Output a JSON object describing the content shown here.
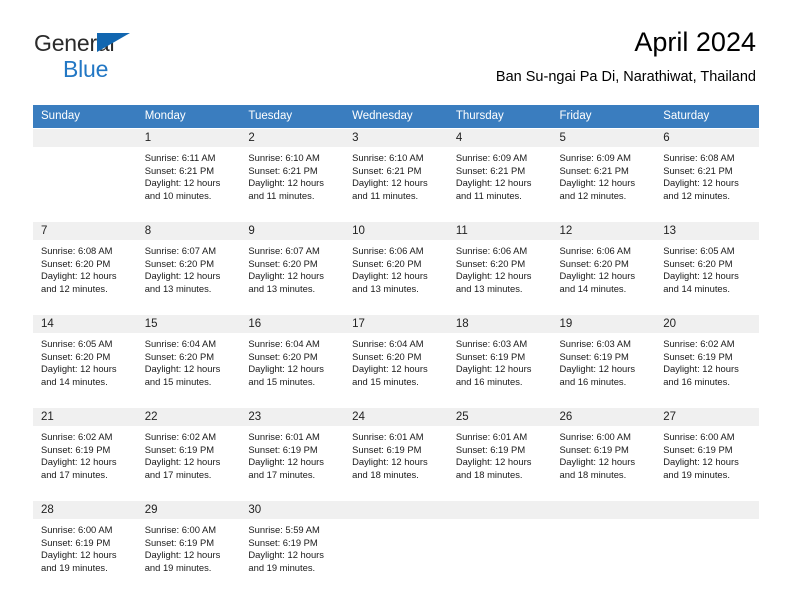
{
  "brand": {
    "name_part1": "General",
    "name_part2": "Blue",
    "accent_color": "#1166b0",
    "blue_text_color": "#2277c4"
  },
  "header": {
    "title": "April 2024",
    "subtitle": "Ban Su-ngai Pa Di, Narathiwat, Thailand"
  },
  "calendar": {
    "header_bg": "#3a7dbf",
    "daynum_bg": "#f0f0f0",
    "weekdays": [
      "Sunday",
      "Monday",
      "Tuesday",
      "Wednesday",
      "Thursday",
      "Friday",
      "Saturday"
    ],
    "weeks": [
      [
        {
          "day": "",
          "lines": []
        },
        {
          "day": "1",
          "lines": [
            "Sunrise: 6:11 AM",
            "Sunset: 6:21 PM",
            "Daylight: 12 hours",
            "and 10 minutes."
          ]
        },
        {
          "day": "2",
          "lines": [
            "Sunrise: 6:10 AM",
            "Sunset: 6:21 PM",
            "Daylight: 12 hours",
            "and 11 minutes."
          ]
        },
        {
          "day": "3",
          "lines": [
            "Sunrise: 6:10 AM",
            "Sunset: 6:21 PM",
            "Daylight: 12 hours",
            "and 11 minutes."
          ]
        },
        {
          "day": "4",
          "lines": [
            "Sunrise: 6:09 AM",
            "Sunset: 6:21 PM",
            "Daylight: 12 hours",
            "and 11 minutes."
          ]
        },
        {
          "day": "5",
          "lines": [
            "Sunrise: 6:09 AM",
            "Sunset: 6:21 PM",
            "Daylight: 12 hours",
            "and 12 minutes."
          ]
        },
        {
          "day": "6",
          "lines": [
            "Sunrise: 6:08 AM",
            "Sunset: 6:21 PM",
            "Daylight: 12 hours",
            "and 12 minutes."
          ]
        }
      ],
      [
        {
          "day": "7",
          "lines": [
            "Sunrise: 6:08 AM",
            "Sunset: 6:20 PM",
            "Daylight: 12 hours",
            "and 12 minutes."
          ]
        },
        {
          "day": "8",
          "lines": [
            "Sunrise: 6:07 AM",
            "Sunset: 6:20 PM",
            "Daylight: 12 hours",
            "and 13 minutes."
          ]
        },
        {
          "day": "9",
          "lines": [
            "Sunrise: 6:07 AM",
            "Sunset: 6:20 PM",
            "Daylight: 12 hours",
            "and 13 minutes."
          ]
        },
        {
          "day": "10",
          "lines": [
            "Sunrise: 6:06 AM",
            "Sunset: 6:20 PM",
            "Daylight: 12 hours",
            "and 13 minutes."
          ]
        },
        {
          "day": "11",
          "lines": [
            "Sunrise: 6:06 AM",
            "Sunset: 6:20 PM",
            "Daylight: 12 hours",
            "and 13 minutes."
          ]
        },
        {
          "day": "12",
          "lines": [
            "Sunrise: 6:06 AM",
            "Sunset: 6:20 PM",
            "Daylight: 12 hours",
            "and 14 minutes."
          ]
        },
        {
          "day": "13",
          "lines": [
            "Sunrise: 6:05 AM",
            "Sunset: 6:20 PM",
            "Daylight: 12 hours",
            "and 14 minutes."
          ]
        }
      ],
      [
        {
          "day": "14",
          "lines": [
            "Sunrise: 6:05 AM",
            "Sunset: 6:20 PM",
            "Daylight: 12 hours",
            "and 14 minutes."
          ]
        },
        {
          "day": "15",
          "lines": [
            "Sunrise: 6:04 AM",
            "Sunset: 6:20 PM",
            "Daylight: 12 hours",
            "and 15 minutes."
          ]
        },
        {
          "day": "16",
          "lines": [
            "Sunrise: 6:04 AM",
            "Sunset: 6:20 PM",
            "Daylight: 12 hours",
            "and 15 minutes."
          ]
        },
        {
          "day": "17",
          "lines": [
            "Sunrise: 6:04 AM",
            "Sunset: 6:20 PM",
            "Daylight: 12 hours",
            "and 15 minutes."
          ]
        },
        {
          "day": "18",
          "lines": [
            "Sunrise: 6:03 AM",
            "Sunset: 6:19 PM",
            "Daylight: 12 hours",
            "and 16 minutes."
          ]
        },
        {
          "day": "19",
          "lines": [
            "Sunrise: 6:03 AM",
            "Sunset: 6:19 PM",
            "Daylight: 12 hours",
            "and 16 minutes."
          ]
        },
        {
          "day": "20",
          "lines": [
            "Sunrise: 6:02 AM",
            "Sunset: 6:19 PM",
            "Daylight: 12 hours",
            "and 16 minutes."
          ]
        }
      ],
      [
        {
          "day": "21",
          "lines": [
            "Sunrise: 6:02 AM",
            "Sunset: 6:19 PM",
            "Daylight: 12 hours",
            "and 17 minutes."
          ]
        },
        {
          "day": "22",
          "lines": [
            "Sunrise: 6:02 AM",
            "Sunset: 6:19 PM",
            "Daylight: 12 hours",
            "and 17 minutes."
          ]
        },
        {
          "day": "23",
          "lines": [
            "Sunrise: 6:01 AM",
            "Sunset: 6:19 PM",
            "Daylight: 12 hours",
            "and 17 minutes."
          ]
        },
        {
          "day": "24",
          "lines": [
            "Sunrise: 6:01 AM",
            "Sunset: 6:19 PM",
            "Daylight: 12 hours",
            "and 18 minutes."
          ]
        },
        {
          "day": "25",
          "lines": [
            "Sunrise: 6:01 AM",
            "Sunset: 6:19 PM",
            "Daylight: 12 hours",
            "and 18 minutes."
          ]
        },
        {
          "day": "26",
          "lines": [
            "Sunrise: 6:00 AM",
            "Sunset: 6:19 PM",
            "Daylight: 12 hours",
            "and 18 minutes."
          ]
        },
        {
          "day": "27",
          "lines": [
            "Sunrise: 6:00 AM",
            "Sunset: 6:19 PM",
            "Daylight: 12 hours",
            "and 19 minutes."
          ]
        }
      ],
      [
        {
          "day": "28",
          "lines": [
            "Sunrise: 6:00 AM",
            "Sunset: 6:19 PM",
            "Daylight: 12 hours",
            "and 19 minutes."
          ]
        },
        {
          "day": "29",
          "lines": [
            "Sunrise: 6:00 AM",
            "Sunset: 6:19 PM",
            "Daylight: 12 hours",
            "and 19 minutes."
          ]
        },
        {
          "day": "30",
          "lines": [
            "Sunrise: 5:59 AM",
            "Sunset: 6:19 PM",
            "Daylight: 12 hours",
            "and 19 minutes."
          ]
        },
        {
          "day": "",
          "lines": []
        },
        {
          "day": "",
          "lines": []
        },
        {
          "day": "",
          "lines": []
        },
        {
          "day": "",
          "lines": []
        }
      ]
    ]
  }
}
